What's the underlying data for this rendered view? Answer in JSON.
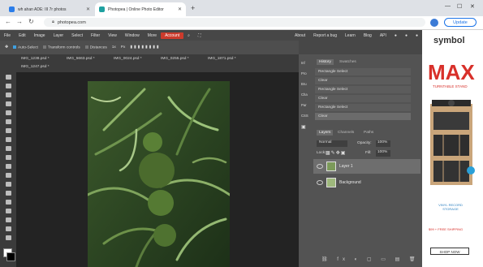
{
  "browser": {
    "tabs": [
      {
        "label": "wh ahan ADE: III 7r photos",
        "active": false
      },
      {
        "label": "Photopea | Online Photo Editor",
        "active": true
      }
    ],
    "new_tab": "+",
    "url": "photopea.com",
    "update_label": "Update"
  },
  "menu": {
    "items": [
      "File",
      "Edit",
      "Image",
      "Layer",
      "Select",
      "Filter",
      "View",
      "Window",
      "More"
    ],
    "account": "Account",
    "right_items": [
      "About",
      "Report a bug",
      "Learn",
      "Blog",
      "API"
    ]
  },
  "options": {
    "auto_select": "Auto-Select",
    "transform": "Transform controls",
    "distances": "Distances",
    "zoom": "1x",
    "px": "Px"
  },
  "doc_tabs": [
    "IMG_1238.psd *",
    "IMG_5663.psd *",
    "IMG_0024.psd *",
    "IMG_0255.psd *",
    "IMG_1871.psd *",
    "IMG_1247.psd *"
  ],
  "side_buttons": [
    "Inf",
    "Pro",
    "Bru",
    "Cha",
    "Par",
    "CSS"
  ],
  "history": {
    "tabs": [
      "History",
      "Swatches"
    ],
    "items": [
      "Rectangle Select",
      "Clear",
      "Rectangle Select",
      "Clear",
      "Rectangle Select",
      "Clear"
    ]
  },
  "layers": {
    "tabs": [
      "Layers",
      "Channels",
      "Paths"
    ],
    "blend": "Normal",
    "opacity_label": "Opacity:",
    "opacity": "100%",
    "lock_label": "Lock:",
    "fill_label": "Fill:",
    "fill": "100%",
    "list": [
      {
        "name": "Layer 1",
        "selected": true
      },
      {
        "name": "Background",
        "selected": false
      }
    ]
  },
  "ad": {
    "brand": "symbol",
    "headline": "MAX",
    "subline": "TURNTABLE STAND",
    "caption": "VINYL RECORD STORAGE",
    "shipping": "$99 + FREE SHIPPING",
    "cta": "SHOP NOW"
  },
  "colors": {
    "accent": "#cc3b2c",
    "app_bg": "#474747",
    "panel_bg": "#535353"
  }
}
